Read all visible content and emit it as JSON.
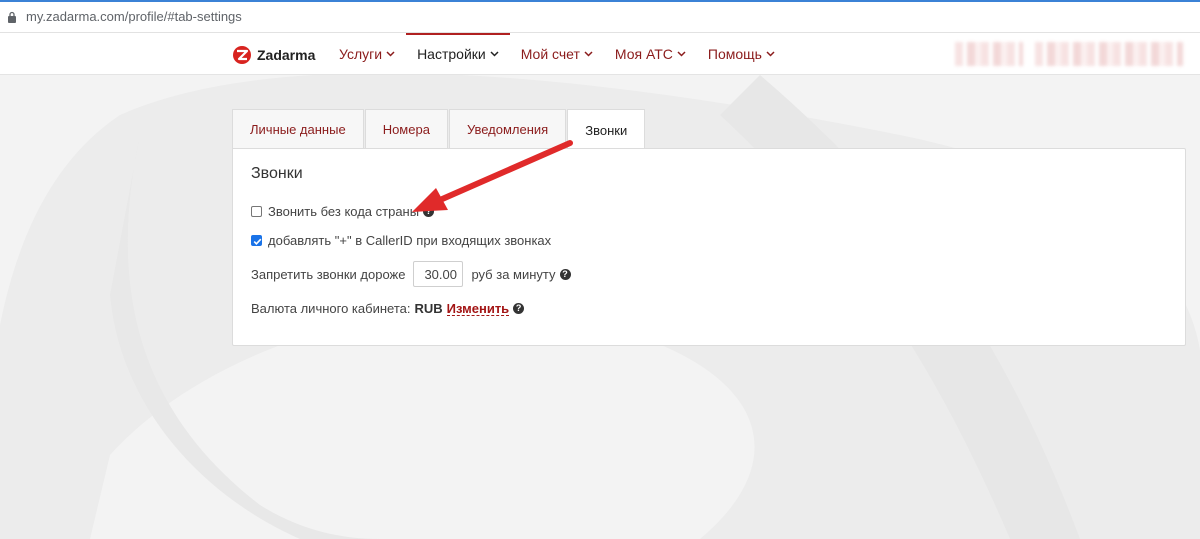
{
  "browser": {
    "url": "my.zadarma.com/profile/#tab-settings"
  },
  "navbar": {
    "logo_text": "Zadarma",
    "menu": [
      {
        "label": "Услуги"
      },
      {
        "label": "Настройки"
      },
      {
        "label": "Мой счет"
      },
      {
        "label": "Моя АТС"
      },
      {
        "label": "Помощь"
      }
    ]
  },
  "tabs": [
    {
      "label": "Личные данные"
    },
    {
      "label": "Номера"
    },
    {
      "label": "Уведомления"
    },
    {
      "label": "Звонки"
    }
  ],
  "panel": {
    "title": "Звонки",
    "call_without_country_code": {
      "label": "Звонить без кода страны",
      "checked": false
    },
    "add_plus_callerid": {
      "label": "добавлять \"+\" в CallerID при входящих звонках",
      "checked": true
    },
    "max_price": {
      "label": "Запретить звонки дороже",
      "value": "30.00",
      "unit": "руб за минуту"
    },
    "currency": {
      "label": "Валюта личного кабинета:",
      "value": "RUB",
      "change_label": "Изменить"
    }
  },
  "colors": {
    "brand_red": "#8b1c1c",
    "link_red": "#a31515",
    "arrow_red": "#e02a2a",
    "checkbox_blue": "#1a73e8"
  }
}
